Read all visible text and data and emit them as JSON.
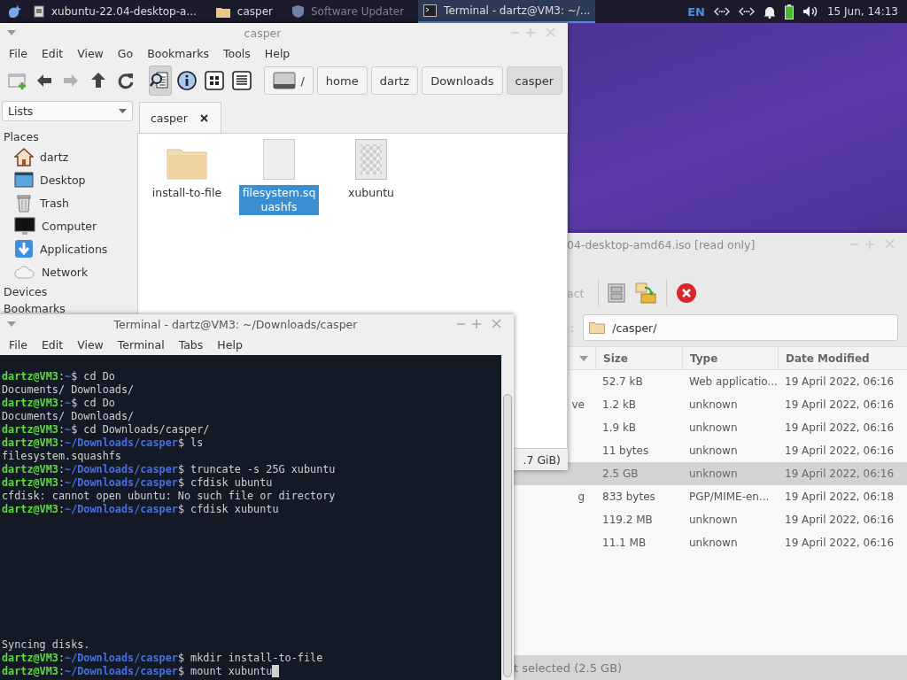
{
  "panel": {
    "tasks": [
      {
        "label": "xubuntu-22.04-desktop-a...",
        "kind": "document",
        "selected": false,
        "minimized": false
      },
      {
        "label": "casper",
        "kind": "folder",
        "selected": false,
        "minimized": false
      },
      {
        "label": "Software Updater",
        "kind": "updater",
        "selected": false,
        "minimized": true
      },
      {
        "label": "Terminal - dartz@VM3: ~/...",
        "kind": "terminal",
        "selected": true,
        "minimized": false
      }
    ],
    "keyboard_layout": "EN",
    "clock": "15 Jun, 14:13"
  },
  "archive_manager": {
    "title": "04-desktop-amd64.iso [read only]",
    "toolbar_label": "act",
    "location_label": ":",
    "location": "/casper/",
    "sort_arrow": true,
    "columns": [
      "Size",
      "Type",
      "Date Modified"
    ],
    "rows": [
      {
        "size": "52.7 kB",
        "type": "Web applicatio...",
        "date": "19 April 2022, 06:16",
        "selected": false
      },
      {
        "name": "ve",
        "size": "1.2 kB",
        "type": "unknown",
        "date": "19 April 2022, 06:16",
        "selected": false
      },
      {
        "size": "1.9 kB",
        "type": "unknown",
        "date": "19 April 2022, 06:16",
        "selected": false
      },
      {
        "size": "11 bytes",
        "type": "unknown",
        "date": "19 April 2022, 06:16",
        "selected": false
      },
      {
        "size": "2.5 GB",
        "type": "unknown",
        "date": "19 April 2022, 06:16",
        "selected": true
      },
      {
        "name": "g",
        "size": "833 bytes",
        "type": "PGP/MIME-en...",
        "date": "19 April 2022, 06:18",
        "selected": false
      },
      {
        "size": "119.2 MB",
        "type": "unknown",
        "date": "19 April 2022, 06:16",
        "selected": false
      },
      {
        "size": "11.1 MB",
        "type": "unknown",
        "date": "19 April 2022, 06:16",
        "selected": false
      }
    ],
    "status": "t selected (2.5 GB)"
  },
  "file_manager": {
    "title": "casper",
    "menu": [
      "File",
      "Edit",
      "View",
      "Go",
      "Bookmarks",
      "Tools",
      "Help"
    ],
    "toolbar": [
      {
        "kind": "new-window",
        "disabled": false,
        "pressed": false
      },
      {
        "kind": "back",
        "disabled": false,
        "pressed": false
      },
      {
        "kind": "forward",
        "disabled": true,
        "pressed": false
      },
      {
        "kind": "up",
        "disabled": false,
        "pressed": false
      },
      {
        "kind": "reload",
        "disabled": false,
        "pressed": false
      },
      {
        "kind": "search",
        "disabled": false,
        "pressed": true
      },
      {
        "kind": "info",
        "disabled": false,
        "pressed": false
      },
      {
        "kind": "icons",
        "disabled": false,
        "pressed": false
      },
      {
        "kind": "list",
        "disabled": false,
        "pressed": false
      }
    ],
    "path": [
      {
        "label": "/",
        "kind": "root",
        "selected": false
      },
      {
        "label": "home",
        "kind": "folder",
        "selected": false
      },
      {
        "label": "dartz",
        "kind": "folder",
        "selected": false
      },
      {
        "label": "Downloads",
        "kind": "folder",
        "selected": false
      },
      {
        "label": "casper",
        "kind": "folder",
        "selected": true
      }
    ],
    "side_view": "Lists",
    "sections": [
      {
        "title": "Places",
        "items": [
          {
            "label": "dartz",
            "kind": "home"
          },
          {
            "label": "Desktop",
            "kind": "desktop"
          },
          {
            "label": "Trash",
            "kind": "trash"
          },
          {
            "label": "Computer",
            "kind": "computer"
          },
          {
            "label": "Applications",
            "kind": "applications"
          },
          {
            "label": "Network",
            "kind": "network"
          }
        ]
      },
      {
        "title": "Devices"
      },
      {
        "title": "Bookmarks"
      }
    ],
    "tabs": [
      {
        "label": "casper",
        "selected": true
      }
    ],
    "files": [
      {
        "name": "install-to-file",
        "kind": "folder",
        "selected": false
      },
      {
        "name": "filesystem.squashfs",
        "kind": "file",
        "selected": true
      },
      {
        "name": "xubuntu",
        "kind": "pattern",
        "selected": false
      }
    ],
    "status": ".7 GiB)"
  },
  "terminal": {
    "title": "Terminal - dartz@VM3: ~/Downloads/casper",
    "menu": [
      "File",
      "Edit",
      "View",
      "Terminal",
      "Tabs",
      "Help"
    ],
    "lines": [
      {
        "kind": "prompt",
        "user": "dartz@VM3",
        "sep": ":",
        "path": "~",
        "command": "$ cd Do"
      },
      {
        "kind": "output",
        "text": "Documents/ Downloads/"
      },
      {
        "kind": "prompt",
        "user": "dartz@VM3",
        "sep": ":",
        "path": "~",
        "command": "$ cd Do"
      },
      {
        "kind": "output",
        "text": "Documents/ Downloads/"
      },
      {
        "kind": "prompt",
        "user": "dartz@VM3",
        "sep": ":",
        "path": "~",
        "command": "$ cd Downloads/casper/"
      },
      {
        "kind": "prompt",
        "user": "dartz@VM3",
        "sep": ":",
        "path": "~/Downloads/casper",
        "command": "$ ls"
      },
      {
        "kind": "output",
        "text": "filesystem.squashfs"
      },
      {
        "kind": "prompt",
        "user": "dartz@VM3",
        "sep": ":",
        "path": "~/Downloads/casper",
        "command": "$ truncate -s 25G xubuntu"
      },
      {
        "kind": "prompt",
        "user": "dartz@VM3",
        "sep": ":",
        "path": "~/Downloads/casper",
        "command": "$ cfdisk ubuntu"
      },
      {
        "kind": "output",
        "text": "cfdisk: cannot open ubuntu: No such file or directory"
      },
      {
        "kind": "prompt",
        "user": "dartz@VM3",
        "sep": ":",
        "path": "~/Downloads/casper",
        "command": "$ cfdisk xubuntu"
      }
    ],
    "bottom_lines": [
      {
        "kind": "output",
        "text": "Syncing disks."
      },
      {
        "kind": "prompt",
        "user": "dartz@VM3",
        "sep": ":",
        "path": "~/Downloads/casper",
        "command": "$ mkdir install-to-file"
      },
      {
        "kind": "prompt",
        "user": "dartz@VM3",
        "sep": ":",
        "path": "~/Downloads/casper",
        "command": "$ mount xubuntu",
        "cursor": true
      }
    ]
  }
}
